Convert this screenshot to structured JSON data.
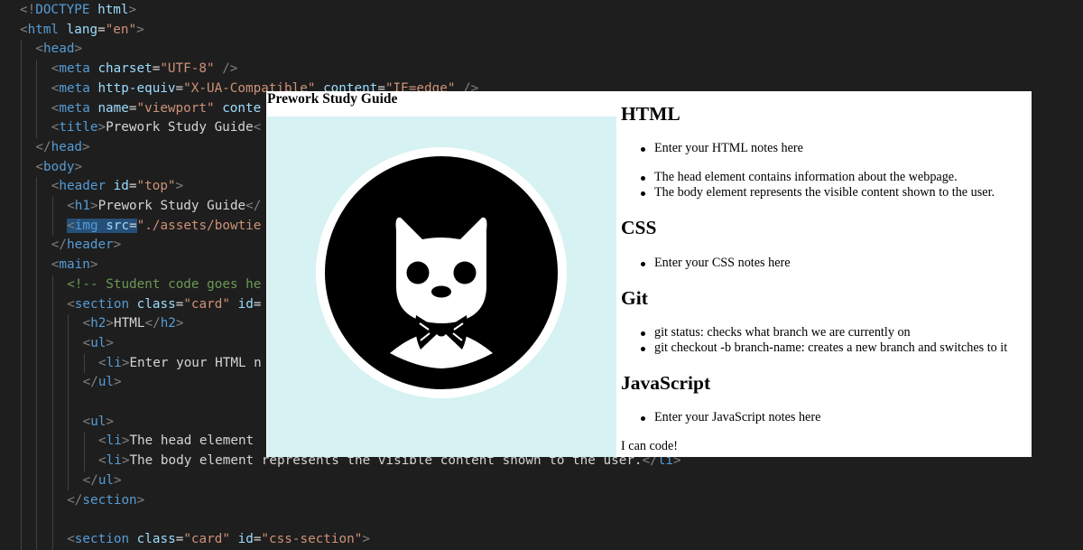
{
  "editor": {
    "lines": [
      {
        "indent": 0,
        "tokens": [
          [
            "t-punc",
            "<!"
          ],
          [
            "t-tag",
            "DOCTYPE"
          ],
          [
            "t-text",
            " "
          ],
          [
            "t-attr",
            "html"
          ],
          [
            "t-punc",
            ">"
          ]
        ]
      },
      {
        "indent": 0,
        "tokens": [
          [
            "t-punc",
            "<"
          ],
          [
            "t-tag",
            "html"
          ],
          [
            "t-text",
            " "
          ],
          [
            "t-attr",
            "lang"
          ],
          [
            "t-text",
            "="
          ],
          [
            "t-str",
            "\"en\""
          ],
          [
            "t-punc",
            ">"
          ]
        ]
      },
      {
        "indent": 1,
        "tokens": [
          [
            "t-punc",
            "<"
          ],
          [
            "t-tag",
            "head"
          ],
          [
            "t-punc",
            ">"
          ]
        ]
      },
      {
        "indent": 2,
        "tokens": [
          [
            "t-punc",
            "<"
          ],
          [
            "t-tag",
            "meta"
          ],
          [
            "t-text",
            " "
          ],
          [
            "t-attr",
            "charset"
          ],
          [
            "t-text",
            "="
          ],
          [
            "t-str",
            "\"UTF-8\""
          ],
          [
            "t-text",
            " "
          ],
          [
            "t-punc",
            "/>"
          ]
        ]
      },
      {
        "indent": 2,
        "tokens": [
          [
            "t-punc",
            "<"
          ],
          [
            "t-tag",
            "meta"
          ],
          [
            "t-text",
            " "
          ],
          [
            "t-attr",
            "http-equiv"
          ],
          [
            "t-text",
            "="
          ],
          [
            "t-str",
            "\"X-UA-Compatible\""
          ],
          [
            "t-text",
            " "
          ],
          [
            "t-attr",
            "content"
          ],
          [
            "t-text",
            "="
          ],
          [
            "t-str",
            "\"IE=edge\""
          ],
          [
            "t-text",
            " "
          ],
          [
            "t-punc",
            "/>"
          ]
        ]
      },
      {
        "indent": 2,
        "tokens": [
          [
            "t-punc",
            "<"
          ],
          [
            "t-tag",
            "meta"
          ],
          [
            "t-text",
            " "
          ],
          [
            "t-attr",
            "name"
          ],
          [
            "t-text",
            "="
          ],
          [
            "t-str",
            "\"viewport\""
          ],
          [
            "t-text",
            " "
          ],
          [
            "t-attr",
            "conte"
          ]
        ]
      },
      {
        "indent": 2,
        "tokens": [
          [
            "t-punc",
            "<"
          ],
          [
            "t-tag",
            "title"
          ],
          [
            "t-punc",
            ">"
          ],
          [
            "t-text",
            "Prework Study Guide"
          ],
          [
            "t-punc",
            "<"
          ]
        ]
      },
      {
        "indent": 1,
        "tokens": [
          [
            "t-punc",
            "</"
          ],
          [
            "t-tag",
            "head"
          ],
          [
            "t-punc",
            ">"
          ]
        ]
      },
      {
        "indent": 1,
        "tokens": [
          [
            "t-punc",
            "<"
          ],
          [
            "t-tag",
            "body"
          ],
          [
            "t-punc",
            ">"
          ]
        ]
      },
      {
        "indent": 2,
        "tokens": [
          [
            "t-punc",
            "<"
          ],
          [
            "t-tag",
            "header"
          ],
          [
            "t-text",
            " "
          ],
          [
            "t-attr",
            "id"
          ],
          [
            "t-text",
            "="
          ],
          [
            "t-str",
            "\"top\""
          ],
          [
            "t-punc",
            ">"
          ]
        ]
      },
      {
        "indent": 3,
        "tokens": [
          [
            "t-punc",
            "<"
          ],
          [
            "t-tag",
            "h1"
          ],
          [
            "t-punc",
            ">"
          ],
          [
            "t-text",
            "Prework Study Guide"
          ],
          [
            "t-punc",
            "</"
          ]
        ]
      },
      {
        "indent": 3,
        "selected": true,
        "tokens": [
          [
            "t-punc",
            "<"
          ],
          [
            "t-tag",
            "img"
          ],
          [
            "t-text",
            " "
          ],
          [
            "t-attr",
            "src"
          ],
          [
            "t-text",
            "="
          ],
          [
            "t-str",
            "\"./assets/bowtie"
          ]
        ]
      },
      {
        "indent": 2,
        "tokens": [
          [
            "t-punc",
            "</"
          ],
          [
            "t-tag",
            "header"
          ],
          [
            "t-punc",
            ">"
          ]
        ]
      },
      {
        "indent": 2,
        "tokens": [
          [
            "t-punc",
            "<"
          ],
          [
            "t-tag",
            "main"
          ],
          [
            "t-punc",
            ">"
          ]
        ]
      },
      {
        "indent": 3,
        "tokens": [
          [
            "t-comment",
            "<!-- Student code goes he"
          ]
        ]
      },
      {
        "indent": 3,
        "tokens": [
          [
            "t-punc",
            "<"
          ],
          [
            "t-tag",
            "section"
          ],
          [
            "t-text",
            " "
          ],
          [
            "t-attr",
            "class"
          ],
          [
            "t-text",
            "="
          ],
          [
            "t-str",
            "\"card\""
          ],
          [
            "t-text",
            " "
          ],
          [
            "t-attr",
            "id"
          ],
          [
            "t-text",
            "="
          ]
        ]
      },
      {
        "indent": 4,
        "tokens": [
          [
            "t-punc",
            "<"
          ],
          [
            "t-tag",
            "h2"
          ],
          [
            "t-punc",
            ">"
          ],
          [
            "t-text",
            "HTML"
          ],
          [
            "t-punc",
            "</"
          ],
          [
            "t-tag",
            "h2"
          ],
          [
            "t-punc",
            ">"
          ]
        ]
      },
      {
        "indent": 4,
        "tokens": [
          [
            "t-punc",
            "<"
          ],
          [
            "t-tag",
            "ul"
          ],
          [
            "t-punc",
            ">"
          ]
        ]
      },
      {
        "indent": 5,
        "tokens": [
          [
            "t-punc",
            "<"
          ],
          [
            "t-tag",
            "li"
          ],
          [
            "t-punc",
            ">"
          ],
          [
            "t-text",
            "Enter your HTML n"
          ]
        ]
      },
      {
        "indent": 4,
        "tokens": [
          [
            "t-punc",
            "</"
          ],
          [
            "t-tag",
            "ul"
          ],
          [
            "t-punc",
            ">"
          ]
        ]
      },
      {
        "indent": 0,
        "tokens": []
      },
      {
        "indent": 4,
        "tokens": [
          [
            "t-punc",
            "<"
          ],
          [
            "t-tag",
            "ul"
          ],
          [
            "t-punc",
            ">"
          ]
        ]
      },
      {
        "indent": 5,
        "tokens": [
          [
            "t-punc",
            "<"
          ],
          [
            "t-tag",
            "li"
          ],
          [
            "t-punc",
            ">"
          ],
          [
            "t-text",
            "The head element"
          ]
        ]
      },
      {
        "indent": 5,
        "tokens": [
          [
            "t-punc",
            "<"
          ],
          [
            "t-tag",
            "li"
          ],
          [
            "t-punc",
            ">"
          ],
          [
            "t-text",
            "The body element represents the visible content shown to the user."
          ],
          [
            "t-punc",
            "</"
          ],
          [
            "t-tag",
            "li"
          ],
          [
            "t-punc",
            ">"
          ]
        ]
      },
      {
        "indent": 4,
        "tokens": [
          [
            "t-punc",
            "</"
          ],
          [
            "t-tag",
            "ul"
          ],
          [
            "t-punc",
            ">"
          ]
        ]
      },
      {
        "indent": 3,
        "tokens": [
          [
            "t-punc",
            "</"
          ],
          [
            "t-tag",
            "section"
          ],
          [
            "t-punc",
            ">"
          ]
        ]
      },
      {
        "indent": 0,
        "tokens": []
      },
      {
        "indent": 3,
        "tokens": [
          [
            "t-punc",
            "<"
          ],
          [
            "t-tag",
            "section"
          ],
          [
            "t-text",
            " "
          ],
          [
            "t-attr",
            "class"
          ],
          [
            "t-text",
            "="
          ],
          [
            "t-str",
            "\"card\""
          ],
          [
            "t-text",
            " "
          ],
          [
            "t-attr",
            "id"
          ],
          [
            "t-text",
            "="
          ],
          [
            "t-str",
            "\"css-section\""
          ],
          [
            "t-punc",
            ">"
          ]
        ]
      }
    ]
  },
  "preview": {
    "site_title": "Prework Study Guide",
    "logo_icon": "bowtie-cat-icon",
    "colors": {
      "logo_bg": "#d6f2f3"
    },
    "sections": [
      {
        "heading": "HTML",
        "lists": [
          [
            "Enter your HTML notes here"
          ],
          [
            "The head element contains information about the webpage.",
            "The body element represents the visible content shown to the user."
          ]
        ]
      },
      {
        "heading": "CSS",
        "lists": [
          [
            "Enter your CSS notes here"
          ]
        ]
      },
      {
        "heading": "Git",
        "lists": [
          [
            "git status: checks what branch we are currently on",
            "git checkout -b branch-name: creates a new branch and switches to it"
          ]
        ]
      },
      {
        "heading": "JavaScript",
        "lists": [
          [
            "Enter your JavaScript notes here"
          ]
        ]
      }
    ],
    "closing_text": "I can code!"
  }
}
